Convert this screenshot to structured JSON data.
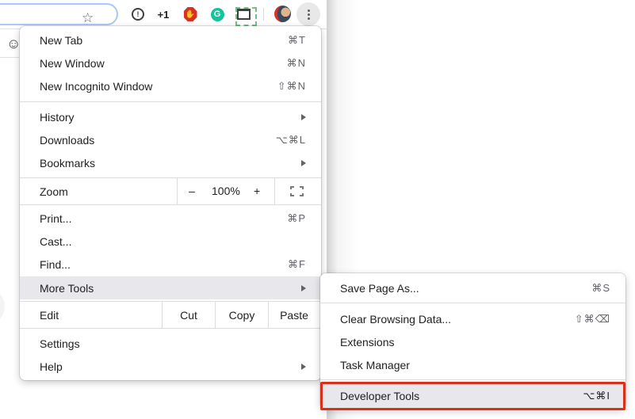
{
  "toolbar": {
    "bookmark_star_icon": "star-outline",
    "extensions": [
      {
        "name": "1password",
        "glyph": "!"
      },
      {
        "name": "plus-one",
        "glyph": "+1"
      },
      {
        "name": "ublock",
        "glyph": "✋"
      },
      {
        "name": "grammarly",
        "glyph": "G"
      },
      {
        "name": "screenshot",
        "glyph": ""
      }
    ],
    "menu_icon": "three-dots-vertical"
  },
  "page": {
    "smiley_icon": "☺"
  },
  "menu": {
    "items": [
      {
        "label": "New Tab",
        "shortcut": "⌘T"
      },
      {
        "label": "New Window",
        "shortcut": "⌘N"
      },
      {
        "label": "New Incognito Window",
        "shortcut": "⇧⌘N"
      },
      {
        "label": "History",
        "submenu": true
      },
      {
        "label": "Downloads",
        "shortcut": "⌥⌘L"
      },
      {
        "label": "Bookmarks",
        "submenu": true
      },
      {
        "label": "Print...",
        "shortcut": "⌘P"
      },
      {
        "label": "Cast..."
      },
      {
        "label": "Find...",
        "shortcut": "⌘F"
      },
      {
        "label": "More Tools",
        "submenu": true,
        "highlighted": true
      },
      {
        "label": "Settings"
      },
      {
        "label": "Help",
        "submenu": true
      }
    ],
    "zoom": {
      "label": "Zoom",
      "minus": "–",
      "value": "100%",
      "plus": "+",
      "fullscreen_icon": "fullscreen-corners"
    },
    "edit": {
      "label": "Edit",
      "cut": "Cut",
      "copy": "Copy",
      "paste": "Paste"
    }
  },
  "submenu": {
    "items": [
      {
        "label": "Save Page As...",
        "shortcut": "⌘S"
      },
      {
        "label": "Clear Browsing Data...",
        "shortcut": "⇧⌘⌫"
      },
      {
        "label": "Extensions"
      },
      {
        "label": "Task Manager"
      },
      {
        "label": "Developer Tools",
        "shortcut": "⌥⌘I",
        "highlighted": true
      }
    ],
    "highlight_color": "#d9301b"
  }
}
